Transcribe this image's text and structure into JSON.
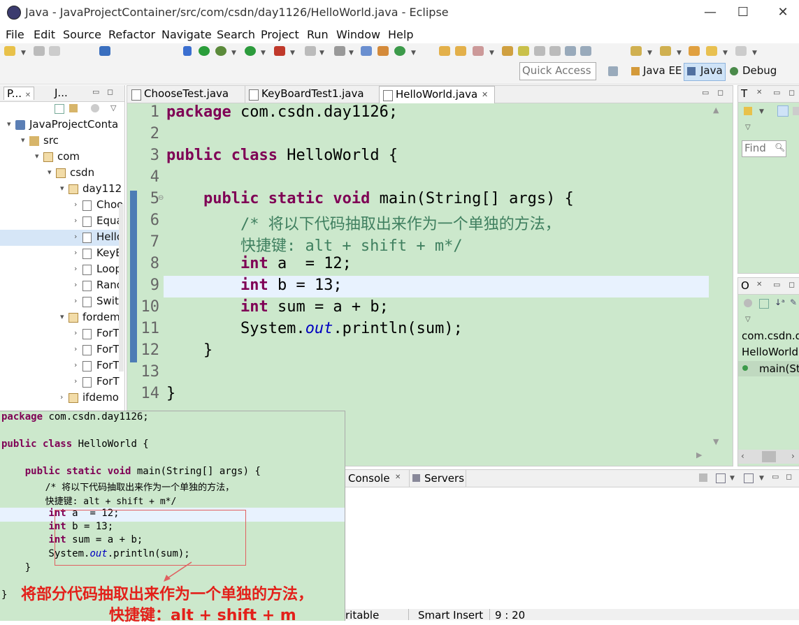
{
  "window": {
    "title": "Java - JavaProjectContainer/src/com/csdn/day1126/HelloWorld.java - Eclipse",
    "minimize": "—",
    "maximize": "☐",
    "close": "✕"
  },
  "menu": [
    "File",
    "Edit",
    "Source",
    "Refactor",
    "Navigate",
    "Search",
    "Project",
    "Run",
    "Window",
    "Help"
  ],
  "toolbar": {
    "quick_access_placeholder": "Quick Access",
    "perspectives": [
      "Java EE",
      "Java",
      "Debug"
    ],
    "active_perspective": "Java"
  },
  "explorer": {
    "tabs": [
      "P...",
      "J..."
    ],
    "tree": [
      {
        "label": "JavaProjectConta",
        "level": 0,
        "twisty": "▾",
        "icon": "project-icon"
      },
      {
        "label": "src",
        "level": 1,
        "twisty": "▾",
        "icon": "source-folder-icon"
      },
      {
        "label": "com",
        "level": 2,
        "twisty": "▾",
        "icon": "package-icon"
      },
      {
        "label": "csdn",
        "level": 3,
        "twisty": "▾",
        "icon": "package-icon"
      },
      {
        "label": "day112",
        "level": 4,
        "twisty": "▾",
        "icon": "package-icon"
      },
      {
        "label": "Choo",
        "level": 5,
        "twisty": "›",
        "icon": "java-file-icon"
      },
      {
        "label": "Equa",
        "level": 5,
        "twisty": "›",
        "icon": "java-file-icon"
      },
      {
        "label": "Hello",
        "level": 5,
        "twisty": "›",
        "icon": "java-file-icon",
        "selected": true
      },
      {
        "label": "KeyB",
        "level": 5,
        "twisty": "›",
        "icon": "java-file-icon"
      },
      {
        "label": "Loop",
        "level": 5,
        "twisty": "›",
        "icon": "java-file-icon"
      },
      {
        "label": "Rand",
        "level": 5,
        "twisty": "›",
        "icon": "java-file-icon"
      },
      {
        "label": "Swit",
        "level": 5,
        "twisty": "›",
        "icon": "java-file-icon"
      },
      {
        "label": "fordem",
        "level": 4,
        "twisty": "▾",
        "icon": "package-icon"
      },
      {
        "label": "ForT",
        "level": 5,
        "twisty": "›",
        "icon": "java-file-icon"
      },
      {
        "label": "ForT",
        "level": 5,
        "twisty": "›",
        "icon": "java-file-icon"
      },
      {
        "label": "ForT",
        "level": 5,
        "twisty": "›",
        "icon": "java-file-icon"
      },
      {
        "label": "ForT",
        "level": 5,
        "twisty": "›",
        "icon": "java-file-icon"
      },
      {
        "label": "ifdemo",
        "level": 4,
        "twisty": "›",
        "icon": "package-icon"
      }
    ]
  },
  "editor": {
    "tabs": [
      "ChooseTest.java",
      "KeyBoardTest1.java",
      "HelloWorld.java"
    ],
    "active_tab": "HelloWorld.java",
    "line_numbers": [
      "1",
      "2",
      "3",
      "4",
      "5",
      "6",
      "7",
      "8",
      "9",
      "10",
      "11",
      "12",
      "13",
      "14"
    ],
    "code": {
      "l1_kw": "package",
      "l1_rest": " com.csdn.day1126;",
      "l3_kw": "public class",
      "l3_rest": " HelloWorld {",
      "l5_indent": "    ",
      "l5_kw": "public static void",
      "l5_rest": " main(String[] args) {",
      "l6": "        /* 将以下代码抽取出来作为一个单独的方法，",
      "l7": "        快捷键: alt + shift + m*/",
      "l8_indent": "        ",
      "l8_kw": "int",
      "l8_rest": " a  = 12;",
      "l9_indent": "        ",
      "l9_kw": "int",
      "l9_rest": " b = 13;",
      "l10_indent": "        ",
      "l10_kw": "int",
      "l10_rest": " sum = a + b;",
      "l11_a": "        System.",
      "l11_fld": "out",
      "l11_b": ".println(sum);",
      "l12": "    }",
      "l14": "}"
    }
  },
  "right_views": {
    "top_tab": "T",
    "find_placeholder": "Find",
    "outline_tab": "O",
    "outline_items": [
      "com.csdn.d",
      "HelloWorld",
      "main(Str"
    ]
  },
  "bottom": {
    "tabs": [
      "Console",
      "Servers"
    ],
    "status": [
      "ritable",
      "Smart Insert",
      "9 : 20"
    ]
  },
  "overlay": {
    "lines": [
      [
        "package",
        " com.csdn.day1126;"
      ],
      [
        "",
        ""
      ],
      [
        "public class",
        " HelloWorld {"
      ],
      [
        "",
        ""
      ],
      [
        "    public static void",
        " main(String[] args) {"
      ]
    ],
    "comment1": "        /* 将以下代码抽取出来作为一个单独的方法，",
    "comment2": "        快捷键: alt + shift + m*/",
    "int_kw": "int",
    "line_a": " a  = 12;",
    "line_b": " b = 13;",
    "line_sum": " sum = a + b;",
    "sys_a": "        System.",
    "sys_out": "out",
    "sys_b": ".println(sum);",
    "close1": "    }",
    "close2": "}",
    "annotation_line1": "将部分代码抽取出来作为一个单独的方法，",
    "annotation_line2": "快捷键：alt + shift + m"
  },
  "colors": {
    "editor_bg": "#cce8cc",
    "keyword": "#7f0055",
    "comment": "#3f7f5f",
    "field": "#0000c0",
    "annotation": "#e3201a"
  }
}
